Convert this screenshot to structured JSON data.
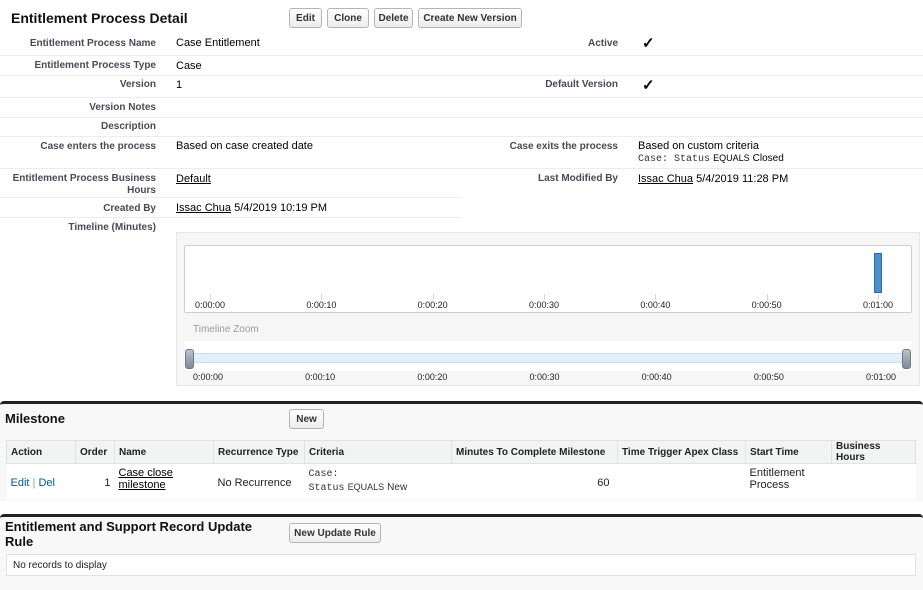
{
  "header": {
    "title": "Entitlement Process Detail",
    "buttons": {
      "edit": "Edit",
      "clone": "Clone",
      "delete": "Delete",
      "create_version": "Create New Version"
    }
  },
  "fields": {
    "name_label": "Entitlement Process Name",
    "name_value": "Case Entitlement",
    "active_label": "Active",
    "active_checked": true,
    "type_label": "Entitlement Process Type",
    "type_value": "Case",
    "version_label": "Version",
    "version_value": "1",
    "default_version_label": "Default Version",
    "default_version_checked": true,
    "version_notes_label": "Version Notes",
    "description_label": "Description",
    "enters_label": "Case enters the process",
    "enters_value": "Based on case created date",
    "exits_label": "Case exits the process",
    "exits_value": "Based on custom criteria",
    "exits_criteria_field": "Case: Status",
    "exits_criteria_op": "EQUALS",
    "exits_criteria_value": "Closed",
    "business_hours_label": "Entitlement Process Business Hours",
    "business_hours_value": "Default",
    "modified_label": "Last Modified By",
    "modified_user": "Issac Chua",
    "modified_date": "5/4/2019 11:28 PM",
    "created_label": "Created By",
    "created_user": "Issac Chua",
    "created_date": "5/4/2019 10:19 PM",
    "timeline_label": "Timeline (Minutes)"
  },
  "timeline": {
    "ticks": [
      "0:00:00",
      "0:00:10",
      "0:00:20",
      "0:00:30",
      "0:00:40",
      "0:00:50",
      "0:01:00"
    ],
    "zoom_label": "Timeline Zoom",
    "milestone_minute": 60,
    "colors": {
      "milestone_bar": "#4a8fd0",
      "zoom_track": "#e4eef8"
    }
  },
  "milestone": {
    "title": "Milestone",
    "new_button": "New",
    "columns": [
      "Action",
      "Order",
      "Name",
      "Recurrence Type",
      "Criteria",
      "Minutes To Complete Milestone",
      "Time Trigger Apex Class",
      "Start Time",
      "Business Hours"
    ],
    "row": {
      "edit": "Edit",
      "sep": "|",
      "del": "Del",
      "order": "1",
      "name": "Case close milestone",
      "recurrence": "No Recurrence",
      "criteria_obj": "Case:",
      "criteria_field": "Status",
      "criteria_op": "EQUALS",
      "criteria_value": "New",
      "minutes": "60",
      "apex_class": "",
      "start_time": "Entitlement Process",
      "business_hours": ""
    }
  },
  "update_rule": {
    "title": "Entitlement and Support Record Update Rule",
    "new_button": "New Update Rule",
    "empty": "No records to display"
  }
}
